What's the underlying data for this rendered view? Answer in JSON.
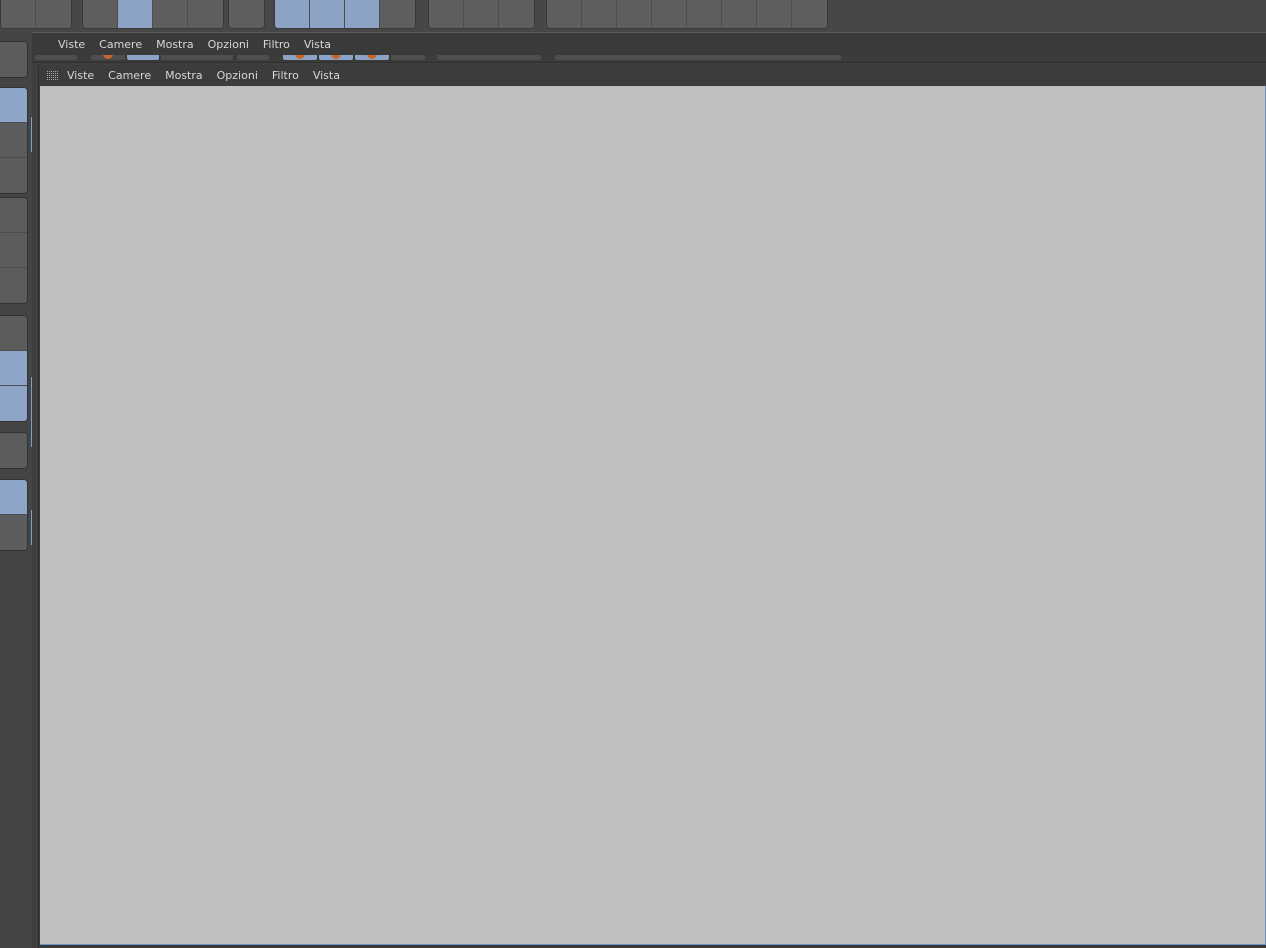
{
  "top_toolbar": {
    "groups": [
      {
        "name": "group-a",
        "buttons": [
          {
            "active": false
          },
          {
            "active": false
          }
        ]
      },
      {
        "name": "group-b",
        "buttons": [
          {
            "active": false
          },
          {
            "active": true
          },
          {
            "active": false
          },
          {
            "active": false
          }
        ]
      },
      {
        "name": "group-c",
        "buttons": [
          {
            "active": false
          }
        ]
      },
      {
        "name": "group-d",
        "buttons": [
          {
            "active": true
          },
          {
            "active": true
          },
          {
            "active": true
          },
          {
            "active": false
          }
        ]
      },
      {
        "name": "group-e",
        "buttons": [
          {
            "active": false
          },
          {
            "active": false
          },
          {
            "active": false
          }
        ]
      },
      {
        "name": "group-f",
        "buttons": [
          {
            "active": false
          },
          {
            "active": false
          },
          {
            "active": false
          },
          {
            "active": false
          },
          {
            "active": false
          },
          {
            "active": false
          },
          {
            "active": false
          },
          {
            "active": false
          }
        ]
      }
    ]
  },
  "left_toolbar": {
    "groups": [
      {
        "buttons": [
          {
            "active": false
          }
        ]
      },
      {
        "buttons": [
          {
            "active": true
          },
          {
            "active": false
          },
          {
            "active": false
          }
        ]
      },
      {
        "buttons": [
          {
            "active": false
          },
          {
            "active": false
          },
          {
            "active": false
          }
        ]
      },
      {
        "buttons": [
          {
            "active": false
          },
          {
            "active": true
          },
          {
            "active": true
          }
        ]
      },
      {
        "buttons": [
          {
            "active": false
          }
        ]
      },
      {
        "buttons": [
          {
            "active": true
          },
          {
            "active": false
          }
        ]
      }
    ]
  },
  "outer_viewport": {
    "menu": [
      "Viste",
      "Camere",
      "Mostra",
      "Opzioni",
      "Filtro",
      "Vista"
    ]
  },
  "inner_viewport": {
    "menu": [
      "Viste",
      "Camere",
      "Mostra",
      "Opzioni",
      "Filtro",
      "Vista"
    ]
  },
  "colors": {
    "accent": "#8da3c6",
    "canvas": "#c0c0c0",
    "panel": "#444444"
  }
}
